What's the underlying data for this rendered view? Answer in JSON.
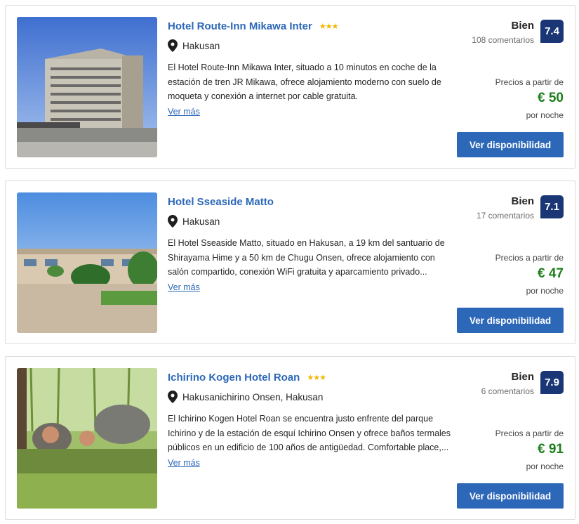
{
  "hotels": [
    {
      "name": "Hotel Route-Inn Mikawa Inter",
      "stars": "★★★",
      "location": "Hakusan",
      "description": "El Hotel Route-Inn Mikawa Inter, situado a 10 minutos en coche de la estación de tren JR Mikawa, ofrece alojamiento moderno con suelo de moqueta y conexión a internet por cable gratuita.",
      "more_label": "Ver más",
      "rating_word": "Bien",
      "reviews": "108 comentarios",
      "score": "7.4",
      "price_from_label": "Precios a partir de",
      "price": "€ 50",
      "per_night_label": "por noche",
      "button_label": "Ver disponibilidad",
      "image_icon": "hotel-building-photo"
    },
    {
      "name": "Hotel Sseaside Matto",
      "stars": "",
      "location": "Hakusan",
      "description": "El Hotel Sseaside Matto, situado en Hakusan, a 19 km del santuario de Shirayama Hime y a 50 km de Chugu Onsen, ofrece alojamiento con salón compartido, conexión WiFi gratuita y aparcamiento privado...",
      "more_label": "Ver más",
      "rating_word": "Bien",
      "reviews": "17 comentarios",
      "score": "7.1",
      "price_from_label": "Precios a partir de",
      "price": "€ 47",
      "per_night_label": "por noche",
      "button_label": "Ver disponibilidad",
      "image_icon": "seaside-hotel-photo"
    },
    {
      "name": "Ichirino Kogen Hotel Roan",
      "stars": "★★★",
      "location": "Hakusanichirino Onsen, Hakusan",
      "description": "El Ichirino Kogen Hotel Roan se encuentra justo enfrente del parque Ichirino y de la estación de esquí Ichirino Onsen y ofrece baños termales públicos en un edificio de 100 años de antigüedad. Comfortable place,...",
      "more_label": "Ver más",
      "rating_word": "Bien",
      "reviews": "6 comentarios",
      "score": "7.9",
      "price_from_label": "Precios a partir de",
      "price": "€ 91",
      "per_night_label": "por noche",
      "button_label": "Ver disponibilidad",
      "image_icon": "onsen-bath-photo"
    }
  ],
  "colors": {
    "link": "#2d68b8",
    "score_bg": "#1a3675",
    "price": "#1c7f1c",
    "stars": "#f2b600",
    "button": "#2d68b8"
  }
}
